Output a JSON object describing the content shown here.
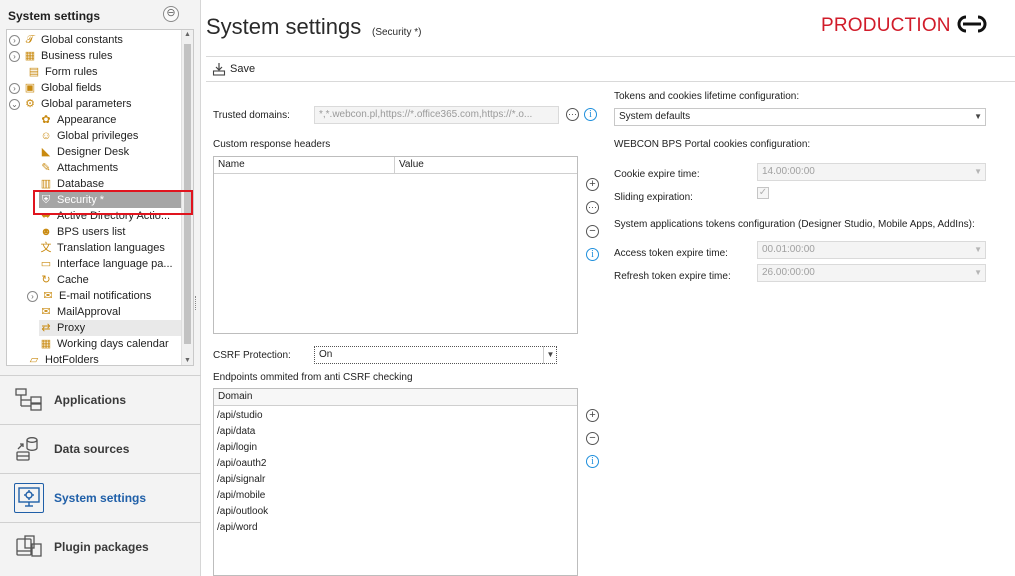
{
  "left_panel": {
    "title": "System settings",
    "collapse_glyph": "⊖",
    "tree": [
      {
        "label": "Global constants",
        "icon": "constants-icon",
        "glyph": "𝒯",
        "expander": "›"
      },
      {
        "label": "Business rules",
        "icon": "business-rules-icon",
        "glyph": "▦",
        "expander": "›"
      },
      {
        "label": "Form rules",
        "icon": "form-rules-icon",
        "glyph": "▤",
        "expander": ""
      },
      {
        "label": "Global fields",
        "icon": "global-fields-icon",
        "glyph": "▣",
        "expander": "›"
      },
      {
        "label": "Global parameters",
        "icon": "gear-icon",
        "glyph": "⚙",
        "expander": "⌄"
      },
      {
        "label": "Appearance",
        "icon": "appearance-icon",
        "glyph": "✿",
        "expander": ""
      },
      {
        "label": "Global privileges",
        "icon": "privileges-icon",
        "glyph": "☺",
        "expander": ""
      },
      {
        "label": "Designer Desk",
        "icon": "designer-desk-icon",
        "glyph": "◣",
        "expander": ""
      },
      {
        "label": "Attachments",
        "icon": "paperclip-icon",
        "glyph": "✎",
        "expander": ""
      },
      {
        "label": "Database",
        "icon": "database-icon",
        "glyph": "▥",
        "expander": ""
      },
      {
        "label": "Security *",
        "icon": "shield-icon",
        "glyph": "⛨",
        "expander": ""
      },
      {
        "label": "Active Directory Actio...",
        "icon": "directory-icon",
        "glyph": "⬌",
        "expander": ""
      },
      {
        "label": "BPS users list",
        "icon": "users-icon",
        "glyph": "☻",
        "expander": ""
      },
      {
        "label": "Translation languages",
        "icon": "translation-icon",
        "glyph": "文",
        "expander": ""
      },
      {
        "label": "Interface language pa...",
        "icon": "language-pack-icon",
        "glyph": "▭",
        "expander": ""
      },
      {
        "label": "Cache",
        "icon": "refresh-icon",
        "glyph": "↻",
        "expander": ""
      },
      {
        "label": "E-mail notifications",
        "icon": "email-icon",
        "glyph": "✉",
        "expander": "›"
      },
      {
        "label": "MailApproval",
        "icon": "mail-approval-icon",
        "glyph": "✉",
        "expander": ""
      },
      {
        "label": "Proxy",
        "icon": "proxy-icon",
        "glyph": "⇄",
        "expander": ""
      },
      {
        "label": "Working days calendar",
        "icon": "calendar-icon",
        "glyph": "▦",
        "expander": ""
      },
      {
        "label": "HotFolders",
        "icon": "folder-icon",
        "glyph": "▱",
        "expander": ""
      }
    ],
    "nav_buttons": [
      {
        "label": "Applications",
        "icon": "applications-icon"
      },
      {
        "label": "Data sources",
        "icon": "data-sources-icon"
      },
      {
        "label": "System settings",
        "icon": "system-settings-icon"
      },
      {
        "label": "Plugin packages",
        "icon": "plugin-packages-icon"
      }
    ]
  },
  "header": {
    "title": "System settings",
    "subtitle": "(Security *)",
    "logo_text": "PRODUCTION"
  },
  "toolbar": {
    "save_label": "Save"
  },
  "left_form": {
    "trusted_domains_label": "Trusted domains:",
    "trusted_domains_value": "*,*.webcon.pl,https://*.office365.com,https://*.o...",
    "custom_headers_label": "Custom response headers",
    "custom_headers_columns": [
      "Name",
      "Value"
    ],
    "csrf_label": "CSRF Protection:",
    "csrf_value": "On",
    "endpoints_label": "Endpoints ommited from anti CSRF checking",
    "endpoints_column": "Domain",
    "endpoints": [
      "/api/studio",
      "/api/data",
      "/api/login",
      "/api/oauth2",
      "/api/signalr",
      "/api/mobile",
      "/api/outlook",
      "/api/word"
    ]
  },
  "right_form": {
    "tokens_label": "Tokens and cookies lifetime configuration:",
    "tokens_value": "System defaults",
    "portal_cookies_label": "WEBCON BPS Portal cookies configuration:",
    "cookie_expire_label": "Cookie expire time:",
    "cookie_expire_value": "14.00:00:00",
    "sliding_label": "Sliding expiration:",
    "sliding_checked": true,
    "system_tokens_label": "System applications tokens configuration (Designer Studio, Mobile Apps, AddIns):",
    "access_token_label": "Access token expire time:",
    "access_token_value": "00.01:00:00",
    "refresh_token_label": "Refresh token expire time:",
    "refresh_token_value": "26.00:00:00"
  },
  "colors": {
    "accent": "#1f5fa8",
    "brand": "#d11c2a",
    "highlight": "#e0141e",
    "info": "#1f8fdc"
  }
}
